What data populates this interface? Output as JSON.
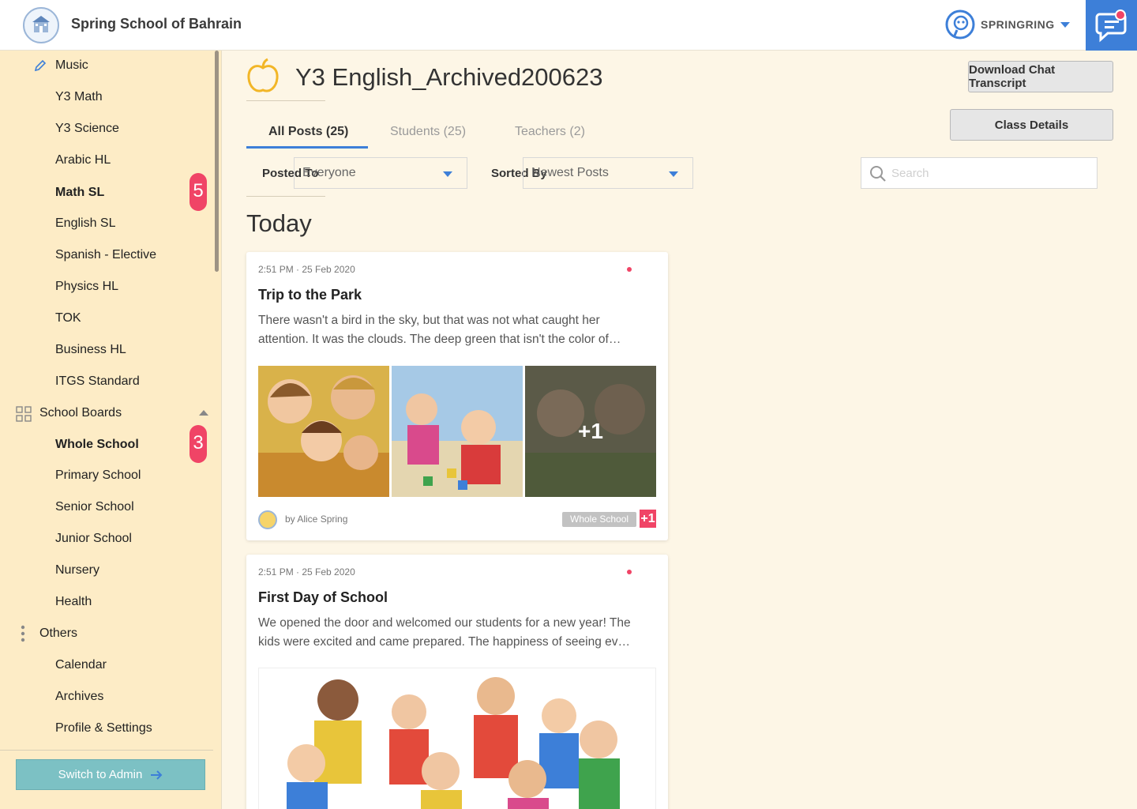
{
  "header": {
    "school_name": "Spring School of Bahrain",
    "brand_name": "SPRINGRING",
    "chat_icon": "chat-icon"
  },
  "sidebar": {
    "items": [
      {
        "label": "Music",
        "bold": false,
        "icon": "pencil-icon"
      },
      {
        "label": "Y3 Math",
        "bold": false
      },
      {
        "label": "Y3 Science",
        "bold": false
      },
      {
        "label": "Arabic HL",
        "bold": false
      },
      {
        "label": "Math SL",
        "bold": true,
        "badge": "5"
      },
      {
        "label": "English SL",
        "bold": false
      },
      {
        "label": "Spanish - Elective",
        "bold": false
      },
      {
        "label": "Physics HL",
        "bold": false
      },
      {
        "label": "TOK",
        "bold": false
      },
      {
        "label": "Business HL",
        "bold": false
      },
      {
        "label": "ITGS Standard",
        "bold": false
      }
    ],
    "boards_section": {
      "label": "School Boards",
      "icon": "grid-icon"
    },
    "boards": [
      {
        "label": "Whole School",
        "bold": true,
        "badge": "3"
      },
      {
        "label": "Primary School",
        "bold": false
      },
      {
        "label": "Senior School",
        "bold": false
      },
      {
        "label": "Junior School",
        "bold": false
      },
      {
        "label": "Nursery",
        "bold": false
      },
      {
        "label": "Health",
        "bold": false
      }
    ],
    "others_section": {
      "label": "Others",
      "icon": "more-vertical-icon"
    },
    "others": [
      {
        "label": "Calendar"
      },
      {
        "label": "Archives"
      },
      {
        "label": "Profile & Settings"
      }
    ],
    "admin_button": "Switch to Admin"
  },
  "main": {
    "title": "Y3 English_Archived200623",
    "download_button": "Download Chat Transcript",
    "class_details_button": "Class Details",
    "tabs": [
      {
        "label": "All Posts (25)",
        "active": true
      },
      {
        "label": "Students (25)",
        "active": false
      },
      {
        "label": "Teachers (2)",
        "active": false
      }
    ],
    "filters": {
      "posted_to_label": "Posted To",
      "posted_to_value": "Everyone",
      "sorted_by_label": "Sorted By",
      "sorted_by_value": "Newest Posts",
      "search_placeholder": "Search"
    },
    "section_title": "Today",
    "posts": [
      {
        "time": "2:51 PM · 25 Feb 2020",
        "title": "Trip to the Park",
        "body": "There wasn't a bird in the sky, but that was not what caught her attention. It was the clouds. The deep green that isn't the color of…",
        "more_photos": "+1",
        "author": "by Alice Spring",
        "tag": "Whole School",
        "tag_more": "+1"
      },
      {
        "time": "2:51 PM · 25 Feb 2020",
        "title": "First Day of School",
        "body": "We opened the door and welcomed our students for a new year! The kids were excited and came prepared. The happiness of seeing ev…"
      }
    ]
  },
  "colors": {
    "accent": "#3d7fd8",
    "badge": "#f04466",
    "sidebar_bg": "#fdecc6",
    "page_bg": "#fdf6e6",
    "admin_button": "#7cc1c4"
  }
}
